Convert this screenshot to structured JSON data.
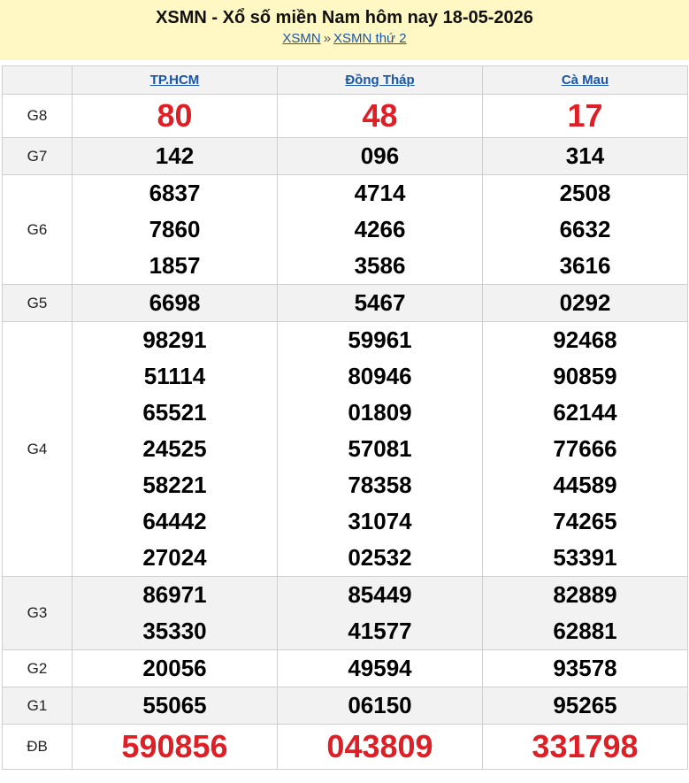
{
  "header": {
    "title": "XSMN - Xổ số miền Nam hôm nay 18-05-2026",
    "breadcrumb": [
      {
        "label": "XSMN"
      },
      {
        "label": "XSMN thứ 2"
      }
    ],
    "separator": "»"
  },
  "provinces": [
    "TP.HCM",
    "Đồng Tháp",
    "Cà Mau"
  ],
  "prizes": [
    {
      "label": "G8",
      "values": [
        [
          "80"
        ],
        [
          "48"
        ],
        [
          "17"
        ]
      ]
    },
    {
      "label": "G7",
      "values": [
        [
          "142"
        ],
        [
          "096"
        ],
        [
          "314"
        ]
      ]
    },
    {
      "label": "G6",
      "values": [
        [
          "6837",
          "7860",
          "1857"
        ],
        [
          "4714",
          "4266",
          "3586"
        ],
        [
          "2508",
          "6632",
          "3616"
        ]
      ]
    },
    {
      "label": "G5",
      "values": [
        [
          "6698"
        ],
        [
          "5467"
        ],
        [
          "0292"
        ]
      ]
    },
    {
      "label": "G4",
      "values": [
        [
          "98291",
          "51114",
          "65521",
          "24525",
          "58221",
          "64442",
          "27024"
        ],
        [
          "59961",
          "80946",
          "01809",
          "57081",
          "78358",
          "31074",
          "02532"
        ],
        [
          "92468",
          "90859",
          "62144",
          "77666",
          "44589",
          "74265",
          "53391"
        ]
      ]
    },
    {
      "label": "G3",
      "values": [
        [
          "86971",
          "35330"
        ],
        [
          "85449",
          "41577"
        ],
        [
          "82889",
          "62881"
        ]
      ]
    },
    {
      "label": "G2",
      "values": [
        [
          "20056"
        ],
        [
          "49594"
        ],
        [
          "93578"
        ]
      ]
    },
    {
      "label": "G1",
      "values": [
        [
          "55065"
        ],
        [
          "06150"
        ],
        [
          "95265"
        ]
      ]
    },
    {
      "label": "ĐB",
      "values": [
        [
          "590856"
        ],
        [
          "043809"
        ],
        [
          "331798"
        ]
      ]
    }
  ],
  "colors": {
    "header_bg": "#fff7c4",
    "link": "#1a56a8",
    "highlight_red": "#e01e25",
    "alt_row": "#f2f2f2"
  }
}
